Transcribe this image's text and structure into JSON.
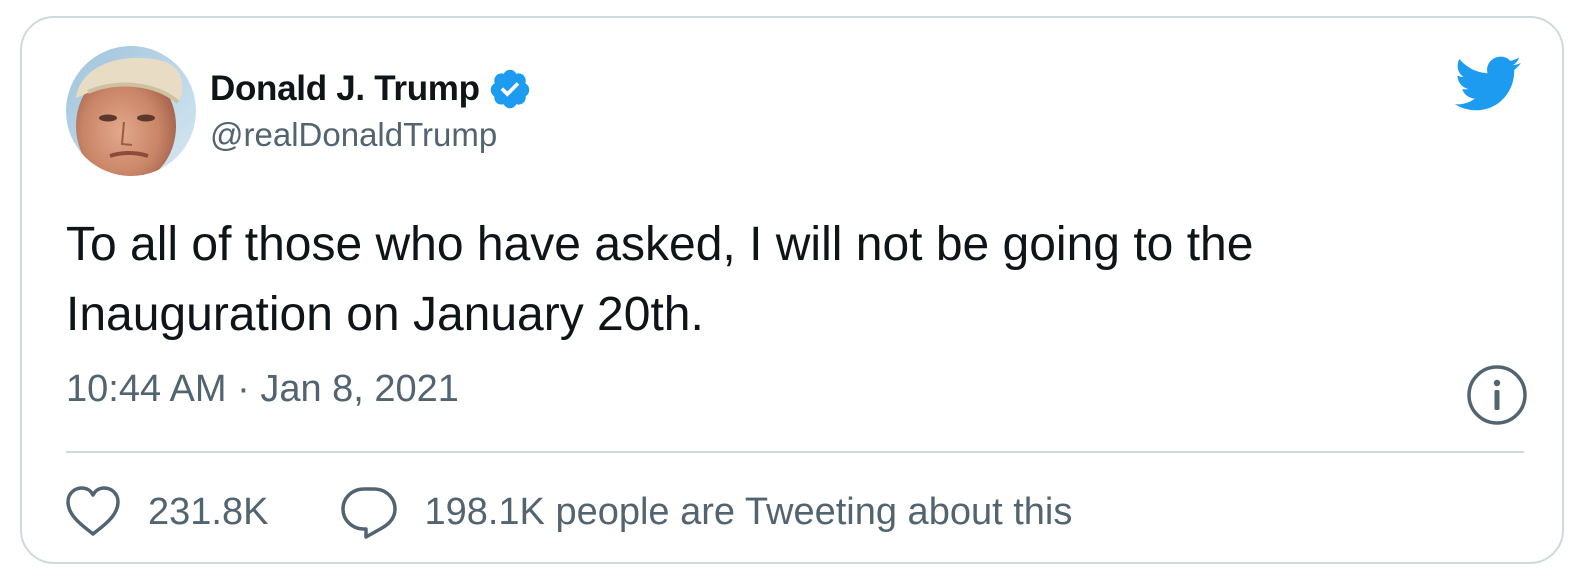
{
  "author": {
    "name": "Donald J. Trump",
    "handle": "@realDonaldTrump",
    "verified": true
  },
  "tweet": {
    "text": "To all of those who have asked, I will not be going to the Inauguration on January 20th.",
    "timestamp": "10:44 AM · Jan 8, 2021"
  },
  "actions": {
    "likes": "231.8K",
    "reply_text": "198.1K people are Tweeting about this"
  },
  "icons": {
    "brand": "twitter-bird-icon",
    "verified": "verified-badge-icon",
    "info": "info-icon",
    "like": "heart-icon",
    "reply": "speech-bubble-icon"
  },
  "colors": {
    "brand_blue": "#1d9bf0",
    "text_primary": "#0f1419",
    "text_secondary": "#536471",
    "border": "#cfd9de"
  }
}
